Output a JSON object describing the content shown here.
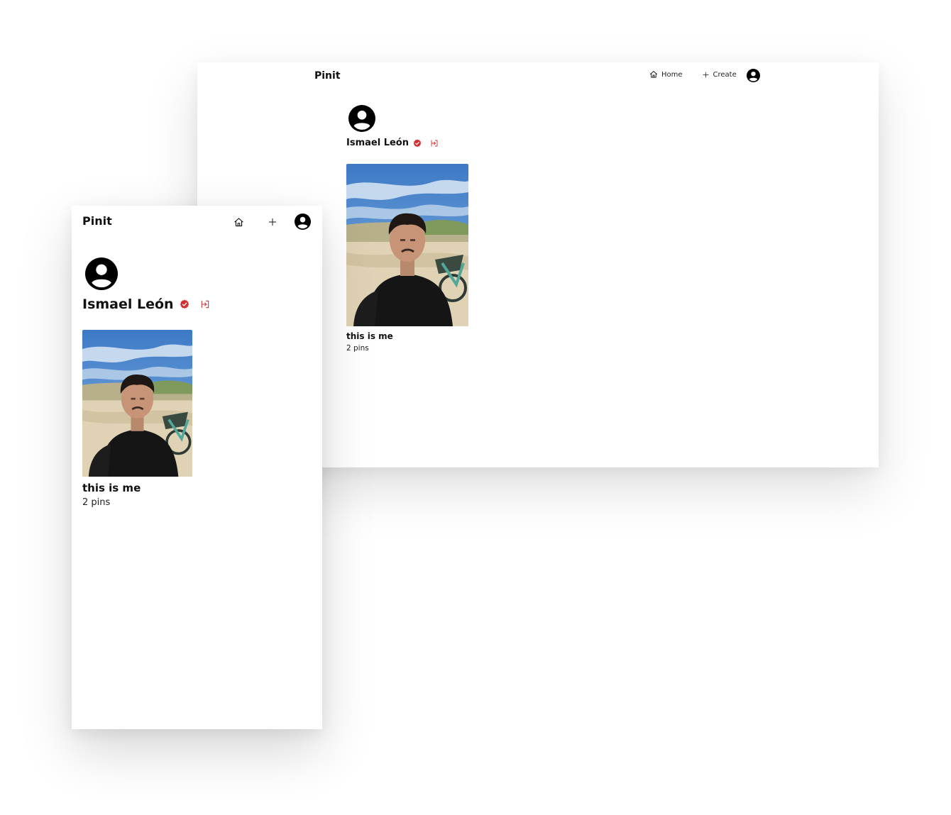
{
  "desktop": {
    "header": {
      "brand": "Pinit",
      "nav": {
        "home_label": "Home",
        "create_label": "Create"
      }
    },
    "profile": {
      "name": "Ismael León"
    },
    "board": {
      "title": "this is me",
      "count": "2 pins"
    }
  },
  "mobile": {
    "header": {
      "brand": "Pinit"
    },
    "profile": {
      "name": "Ismael León"
    },
    "board": {
      "title": "this is me",
      "count": "2 pins"
    }
  },
  "colors": {
    "accent": "#d32f2f",
    "text": "#111111",
    "background": "#ffffff"
  },
  "icons": [
    "home-icon",
    "plus-icon",
    "user-avatar-icon",
    "verified-badge-icon",
    "logout-icon"
  ]
}
